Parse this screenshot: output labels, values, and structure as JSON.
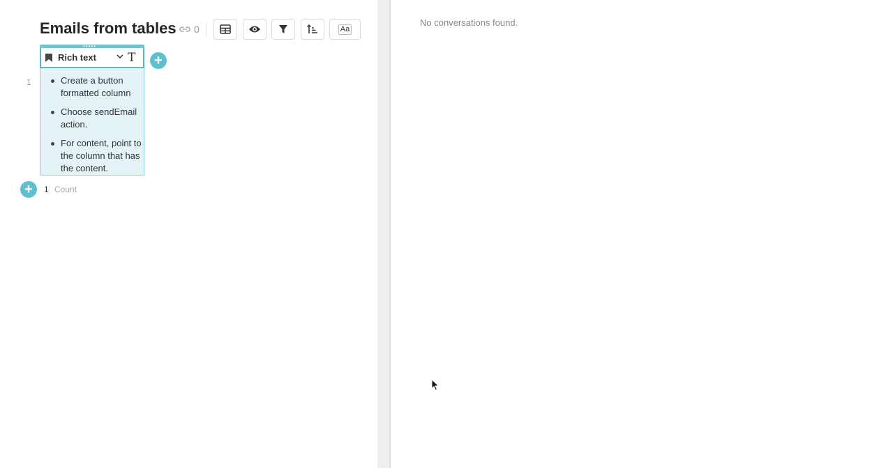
{
  "left": {
    "title": "Emails from tables",
    "link_count": "0",
    "toolbar": [
      {
        "icon": "table-icon"
      },
      {
        "icon": "eye-icon"
      },
      {
        "icon": "filter-icon"
      },
      {
        "icon": "sort-icon"
      },
      {
        "icon": "text-format-icon",
        "label": "Aa"
      }
    ],
    "column": {
      "name": "Rich text",
      "type_glyph": "T"
    },
    "rows": [
      {
        "number": "1",
        "bullets": [
          "Create a button formatted column",
          "Choose sendEmail action.",
          "For content, point to the column that has the content."
        ]
      }
    ],
    "footer": {
      "count": "1",
      "label": "Count"
    }
  },
  "right": {
    "empty_message": "No conversations found."
  },
  "colors": {
    "accent": "#5ec0cf",
    "cell_bg": "#e3f3f6"
  }
}
